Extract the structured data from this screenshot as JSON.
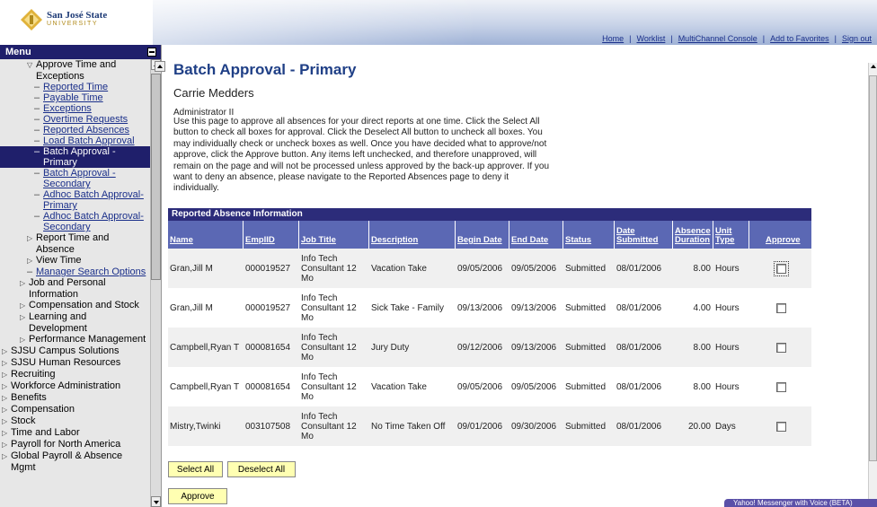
{
  "branding": {
    "logo_line1": "San José State",
    "logo_line2": "UNIVERSITY"
  },
  "top_nav": [
    {
      "label": "Home"
    },
    {
      "label": "Worklist"
    },
    {
      "label": "MultiChannel Console"
    },
    {
      "label": "Add to Favorites"
    },
    {
      "label": "Sign out"
    }
  ],
  "menu": {
    "title": "Menu",
    "items": [
      {
        "label": "Approve Time and",
        "type": "expanded",
        "indent": 1
      },
      {
        "label": "Exceptions",
        "type": "cont",
        "indent": 1
      },
      {
        "label": "Reported Time",
        "type": "link",
        "indent": 2
      },
      {
        "label": "Payable Time",
        "type": "link",
        "indent": 2
      },
      {
        "label": "Exceptions",
        "type": "link",
        "indent": 2
      },
      {
        "label": "Overtime Requests",
        "type": "link",
        "indent": 2
      },
      {
        "label": "Reported Absences",
        "type": "link",
        "indent": 2
      },
      {
        "label": "Load Batch Approval",
        "type": "link",
        "indent": 2
      },
      {
        "label": "Batch Approval -",
        "type": "selected",
        "indent": 2
      },
      {
        "label": "Primary",
        "type": "selected-cont",
        "indent": 2
      },
      {
        "label": "Batch Approval -",
        "type": "link",
        "indent": 2
      },
      {
        "label": "Secondary",
        "type": "link-cont",
        "indent": 2
      },
      {
        "label": "Adhoc Batch Approval-",
        "type": "link",
        "indent": 2
      },
      {
        "label": "Primary",
        "type": "link-cont",
        "indent": 2
      },
      {
        "label": "Adhoc Batch Approval-",
        "type": "link",
        "indent": 2
      },
      {
        "label": "Secondary",
        "type": "link-cont",
        "indent": 2
      },
      {
        "label": "Report Time and",
        "type": "collapsed",
        "indent": 1
      },
      {
        "label": "Absence",
        "type": "cont",
        "indent": 1
      },
      {
        "label": "View Time",
        "type": "collapsed",
        "indent": 1
      },
      {
        "label": "Manager Search Options",
        "type": "link",
        "indent": 1
      },
      {
        "label": "Job and Personal",
        "type": "collapsed",
        "indent": 0
      },
      {
        "label": "Information",
        "type": "cont",
        "indent": 0
      },
      {
        "label": "Compensation and Stock",
        "type": "collapsed",
        "indent": 0
      },
      {
        "label": "Learning and",
        "type": "collapsed",
        "indent": 0
      },
      {
        "label": "Development",
        "type": "cont",
        "indent": 0
      },
      {
        "label": "Performance Management",
        "type": "collapsed",
        "indent": 0
      },
      {
        "label": "SJSU Campus Solutions",
        "type": "collapsed",
        "indent": -1
      },
      {
        "label": "SJSU Human Resources",
        "type": "collapsed",
        "indent": -1
      },
      {
        "label": "Recruiting",
        "type": "collapsed",
        "indent": -1
      },
      {
        "label": "Workforce Administration",
        "type": "collapsed",
        "indent": -1
      },
      {
        "label": "Benefits",
        "type": "collapsed",
        "indent": -1
      },
      {
        "label": "Compensation",
        "type": "collapsed",
        "indent": -1
      },
      {
        "label": "Stock",
        "type": "collapsed",
        "indent": -1
      },
      {
        "label": "Time and Labor",
        "type": "collapsed",
        "indent": -1
      },
      {
        "label": "Payroll for North America",
        "type": "collapsed",
        "indent": -1
      },
      {
        "label": "Global Payroll & Absence",
        "type": "collapsed",
        "indent": -1
      },
      {
        "label": "Mgmt",
        "type": "cont",
        "indent": -1
      }
    ]
  },
  "page": {
    "title": "Batch Approval - Primary",
    "employee_name": "Carrie Medders",
    "employee_role": "Administrator II",
    "instructions": "Use this page to approve all absences for your direct reports at one time. Click the Select All button to check all boxes for approval. Click the Deselect All button to uncheck all boxes. You may individually check or uncheck boxes as well. Once you have decided what to approve/not approve, click the Approve button. Any items left unchecked, and therefore unapproved, will remain on the page and will not be processed unless approved by the back-up approver. If you want to deny an absence, please navigate to the Reported Absences page to deny it individually."
  },
  "grid": {
    "caption": "Reported Absence Information",
    "columns": [
      "Name",
      "EmplID",
      "Job Title",
      "Description",
      "Begin Date",
      "End Date",
      "Status",
      "Date Submitted",
      "Absence Duration",
      "Unit Type",
      "Approve"
    ],
    "rows": [
      {
        "name": "Gran,Jill M",
        "emplid": "000019527",
        "job_title": "Info Tech Consultant 12 Mo",
        "description": "Vacation Take",
        "begin": "09/05/2006",
        "end": "09/05/2006",
        "status": "Submitted",
        "submitted": "08/01/2006",
        "duration": "8.00",
        "unit": "Hours",
        "approve": false
      },
      {
        "name": "Gran,Jill M",
        "emplid": "000019527",
        "job_title": "Info Tech Consultant 12 Mo",
        "description": "Sick Take - Family",
        "begin": "09/13/2006",
        "end": "09/13/2006",
        "status": "Submitted",
        "submitted": "08/01/2006",
        "duration": "4.00",
        "unit": "Hours",
        "approve": false
      },
      {
        "name": "Campbell,Ryan T",
        "emplid": "000081654",
        "job_title": "Info Tech Consultant 12 Mo",
        "description": "Jury Duty",
        "begin": "09/12/2006",
        "end": "09/13/2006",
        "status": "Submitted",
        "submitted": "08/01/2006",
        "duration": "8.00",
        "unit": "Hours",
        "approve": false
      },
      {
        "name": "Campbell,Ryan T",
        "emplid": "000081654",
        "job_title": "Info Tech Consultant 12 Mo",
        "description": "Vacation Take",
        "begin": "09/05/2006",
        "end": "09/05/2006",
        "status": "Submitted",
        "submitted": "08/01/2006",
        "duration": "8.00",
        "unit": "Hours",
        "approve": false
      },
      {
        "name": "Mistry,Twinki",
        "emplid": "003107508",
        "job_title": "Info Tech Consultant 12 Mo",
        "description": "No Time Taken Off",
        "begin": "09/01/2006",
        "end": "09/30/2006",
        "status": "Submitted",
        "submitted": "08/01/2006",
        "duration": "20.00",
        "unit": "Days",
        "approve": false
      }
    ]
  },
  "buttons": {
    "select_all": "Select All",
    "deselect_all": "Deselect All",
    "approve": "Approve"
  },
  "messenger": "Yahoo! Messenger with Voice (BETA)",
  "colors": {
    "header_blue": "#1f1f6b",
    "grid_header": "#5b68b4",
    "title_blue": "#1f3f86",
    "link_blue": "#1a2f8a",
    "button_yellow": "#ffffb2"
  }
}
